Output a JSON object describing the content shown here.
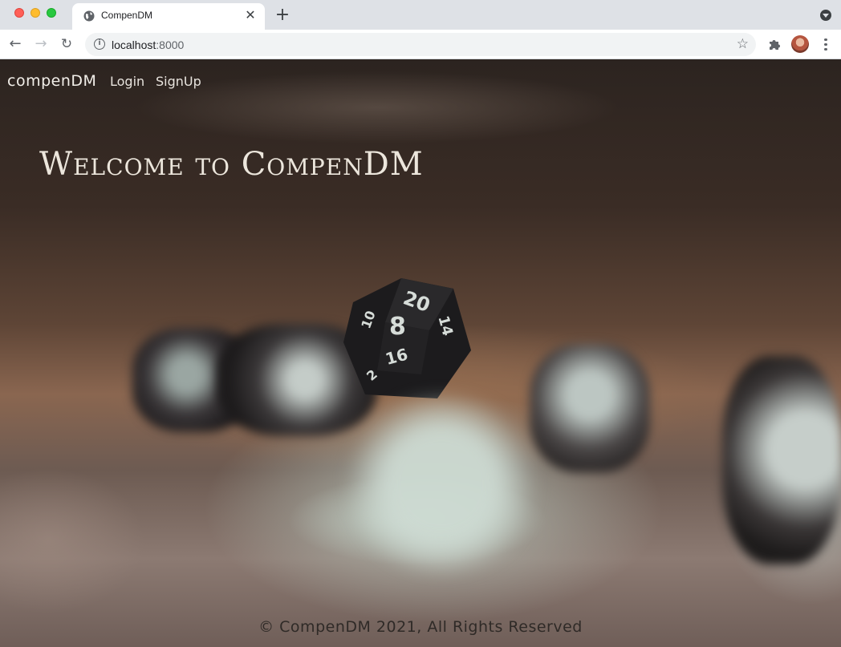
{
  "browser": {
    "tab": {
      "title": "CompenDM",
      "favicon": "globe-icon"
    },
    "address": {
      "host": "localhost",
      "port": ":8000"
    },
    "icons": {
      "back": "back-arrow-icon",
      "forward": "forward-arrow-icon",
      "reload": "reload-icon",
      "info": "info-icon",
      "bookmark": "star-icon",
      "extensions": "puzzle-icon",
      "menu": "kebab-menu-icon"
    }
  },
  "site": {
    "brand": "compenDM",
    "nav": {
      "login": "Login",
      "signup": "SignUp"
    },
    "hero_title": "Welcome to CompenDM",
    "footer": "© CompenDM 2021, All Rights Reserved"
  },
  "colors": {
    "hero_text": "#ece6dc",
    "nav_text": "#e8e4de",
    "footer_text": "#2f2a27"
  }
}
